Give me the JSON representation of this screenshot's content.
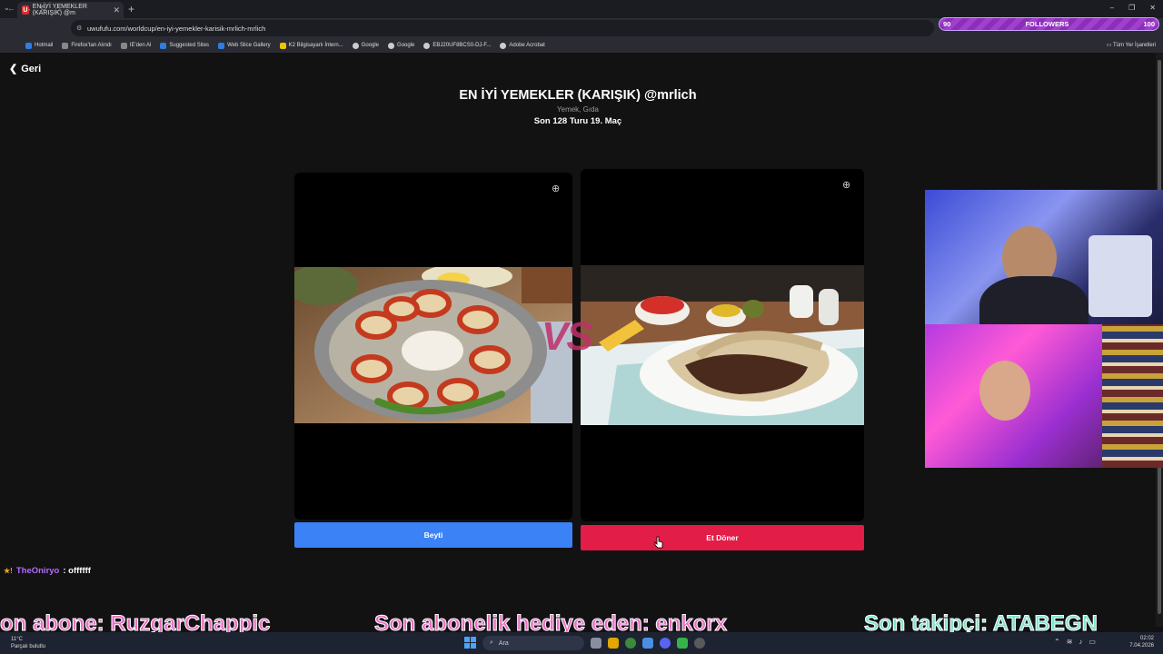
{
  "browser": {
    "tab_title": "EN İYİ YEMEKLER (KARIŞIK) @m",
    "tab_favicon": "U",
    "url": "uwufufu.com/worldcup/en-iyi-yemekler-karisik-mrlich-mrlich",
    "bookmarks": [
      "Hotmail",
      "Firefox'tan Alındı",
      "IE'den Al",
      "Suggested Sites",
      "Web Slice Gallery",
      "K2 Bilgisayarlı İntern...",
      "Google",
      "Google",
      "EBJ20UF8BCS0-DJ-F...",
      "Adobe Acrobat"
    ],
    "all_bookmarks": "Tüm Yer İşaretleri"
  },
  "followers_widget": {
    "current": "90",
    "label": "FOLLOWERS",
    "goal": "100",
    "progress": 0.9
  },
  "page": {
    "back_label": "Geri",
    "title": "EN İYİ YEMEKLER (KARIŞIK) @mrlich",
    "subtitle": "Yemek, Gıda",
    "round": "Son 128 Turu 19. Maç",
    "vs_text": "VS",
    "left_choice": "Beyti",
    "right_choice": "Et Döner"
  },
  "chat": {
    "username": "TheOniryo",
    "message": ": offffff"
  },
  "ticker": {
    "items": [
      {
        "prefix": "on abone: ",
        "name": "RuzgarChappic"
      },
      {
        "prefix": "Son abonelik hediye eden: ",
        "name": "enkorx"
      },
      {
        "prefix": "Son takipçi: ",
        "name": "ATABEGN"
      }
    ]
  },
  "taskbar": {
    "temperature": "11°C",
    "weather": "Parçalı bulutlu",
    "search_placeholder": "Ara",
    "time": "02:02",
    "date": "7.04.2026"
  },
  "colors": {
    "left_button": "#3b82f6",
    "right_button": "#e11d48",
    "ticker_pink": "#e96ec5",
    "ticker_teal": "#7fe3d0"
  }
}
